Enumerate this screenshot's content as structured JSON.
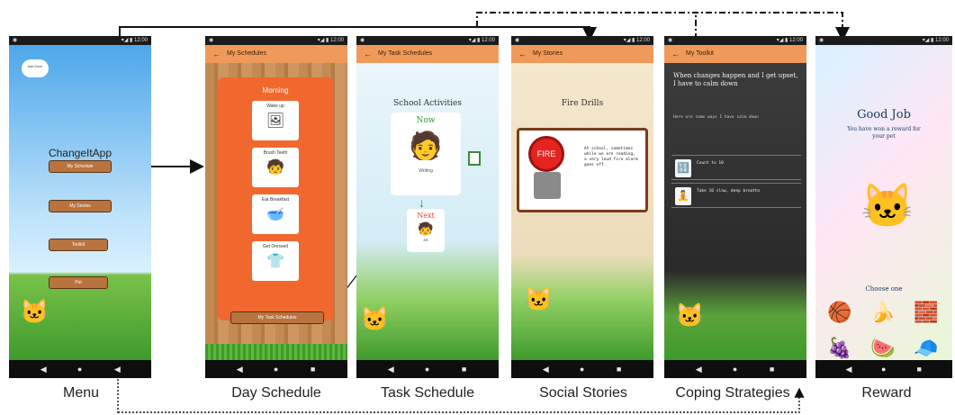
{
  "menu": {
    "cloud_label": "Ask\nMom",
    "app_title": "ChangeItApp",
    "buttons": [
      "My Schedule",
      "My Stories",
      "Toolkit",
      "Pet"
    ],
    "caption": "Menu"
  },
  "day_schedule": {
    "appbar_title": "My Schedules",
    "panel_title": "Morning",
    "cards": [
      {
        "label": "Wake up",
        "icon": "🖼"
      },
      {
        "label": "Brush Teeth",
        "icon": "🧒"
      },
      {
        "label": "Eat Breakfast",
        "icon": "🥣"
      },
      {
        "label": "Get Dressed",
        "icon": "👕"
      }
    ],
    "bottom_button": "My Task Schedules",
    "caption": "Day Schedule"
  },
  "task_schedule": {
    "appbar_title": "My Task Schedules",
    "heading": "School Activities",
    "now_label": "Now",
    "now_activity": "Writing",
    "next_label": "Next",
    "next_activity": "art",
    "caption": "Task Schedule"
  },
  "social_stories": {
    "appbar_title": "My Stories",
    "heading": "Fire Drills",
    "fire_label": "FIRE",
    "story_text": "At school, sometimes while we are reading, a very loud fire alarm goes off.",
    "caption": "Social Stories"
  },
  "coping": {
    "appbar_title": "My Toolkit",
    "headline": "When changes happen and I get upset, I have to calm down",
    "subtext": "Here are some ways I have calm down",
    "items": [
      "Count to 10",
      "Take 10 slow, deep breaths"
    ],
    "caption": "Coping Strategies"
  },
  "reward": {
    "title": "Good Job",
    "subtitle": "You have won a reward for your pet",
    "choose": "Choose one",
    "caption": "Reward"
  },
  "status": {
    "left": "◉",
    "right": "▾◢ ▮ 12:00"
  },
  "nav": {
    "back": "◀",
    "home": "●",
    "recent": "■"
  },
  "appbar_back": "←"
}
